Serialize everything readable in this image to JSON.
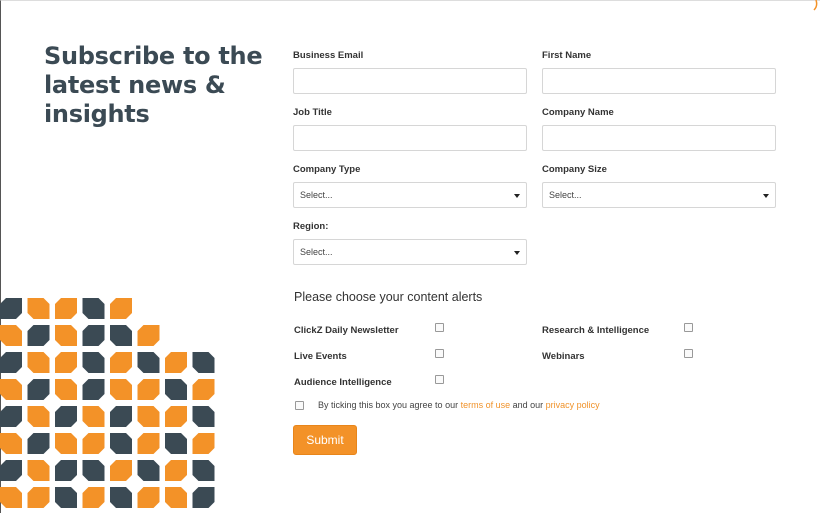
{
  "headline": "Subscribe to the latest news & insights",
  "fields": {
    "business_email": {
      "label": "Business Email",
      "value": ""
    },
    "first_name": {
      "label": "First Name",
      "value": ""
    },
    "job_title": {
      "label": "Job Title",
      "value": ""
    },
    "company_name": {
      "label": "Company Name",
      "value": ""
    },
    "company_type": {
      "label": "Company Type",
      "selected": "Select..."
    },
    "company_size": {
      "label": "Company Size",
      "selected": "Select..."
    },
    "region": {
      "label": "Region:",
      "selected": "Select..."
    }
  },
  "alerts": {
    "title": "Please choose your content alerts",
    "items": [
      {
        "label": "ClickZ Daily Newsletter",
        "checked": false
      },
      {
        "label": "Research & Intelligence",
        "checked": false
      },
      {
        "label": "Live Events",
        "checked": false
      },
      {
        "label": "Webinars",
        "checked": false
      },
      {
        "label": "Audience Intelligence",
        "checked": false
      }
    ]
  },
  "consent": {
    "prefix": "By ticking this box you agree to our ",
    "terms_link": "terms of use",
    "middle": " and our ",
    "privacy_link": "privacy policy",
    "checked": false
  },
  "submit_label": "Submit",
  "colors": {
    "accent": "#f39228",
    "dark": "#3b4a54"
  },
  "icons": {
    "dropdown": "caret-down-icon",
    "corner": "corner-accent-icon"
  }
}
